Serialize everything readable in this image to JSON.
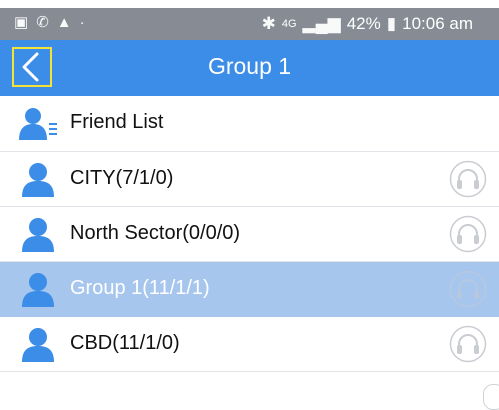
{
  "status_bar": {
    "left_icons": [
      "image-icon",
      "wifi-call-icon",
      "warning-icon",
      "dot-icon"
    ],
    "bluetooth_icon": "bluetooth-icon",
    "network": "4G",
    "battery": "42%",
    "time": "10:06 am"
  },
  "app_bar": {
    "title": "Group 1",
    "back_icon": "chevron-left-icon"
  },
  "list": {
    "friend_list_label": "Friend List",
    "groups": [
      {
        "label": "CITY(7/1/0)",
        "selected": false
      },
      {
        "label": "North Sector(0/0/0)",
        "selected": false
      },
      {
        "label": "Group 1(11/1/1)",
        "selected": true
      },
      {
        "label": "CBD(11/1/0)",
        "selected": false
      }
    ]
  },
  "colors": {
    "app_bar": "#3b8de8",
    "status_bar": "#868b94",
    "selected_row": "#a7c6ee",
    "icon_blue": "#3b8de8",
    "back_outline": "#f4e237"
  }
}
